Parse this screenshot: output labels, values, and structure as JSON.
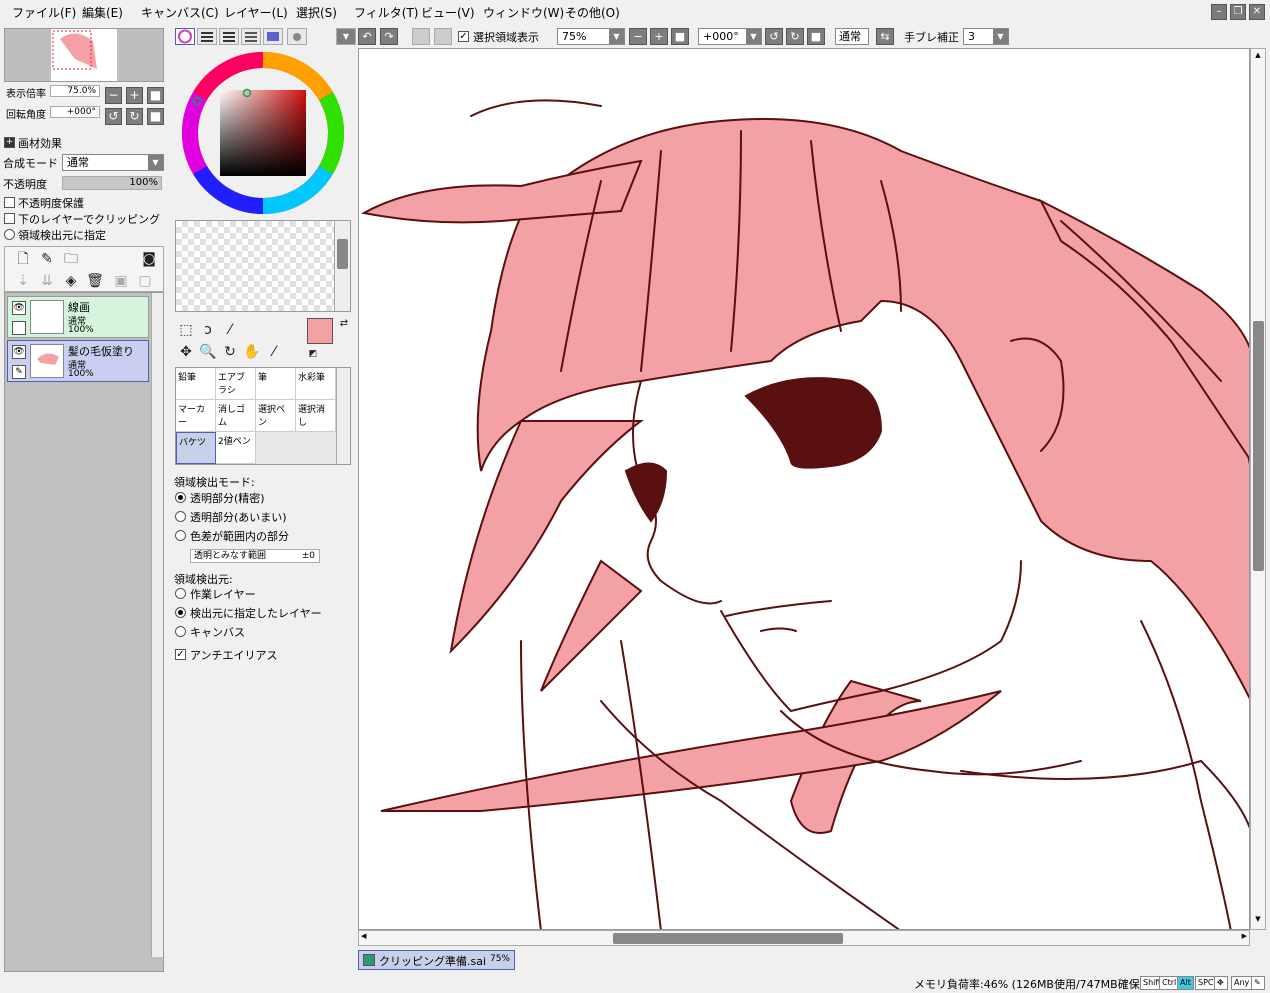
{
  "menu": {
    "items": [
      "ファイル(F)",
      "編集(E)",
      "キャンバス(C)",
      "レイヤー(L)",
      "選択(S)",
      "フィルタ(T)",
      "ビュー(V)",
      "ウィンドウ(W)",
      "その他(O)"
    ]
  },
  "navigator": {
    "zoom_label": "表示倍率",
    "zoom_value": "75.0%",
    "rotation_label": "回転角度",
    "rotation_value": "+000°"
  },
  "layer_panel": {
    "effects_label": "画材効果",
    "blend_label": "合成モード",
    "blend_value": "通常",
    "opacity_label": "不透明度",
    "opacity_value": "100%",
    "opacity_fraction": 1.0,
    "protect_opacity": "不透明度保護",
    "clip_lower": "下のレイヤーでクリッピング",
    "selection_source": "領域検出元に指定",
    "layers": [
      {
        "name": "線画",
        "mode": "通常",
        "opacity": "100%"
      },
      {
        "name": "髪の毛仮塗り",
        "mode": "通常",
        "opacity": "100%"
      }
    ]
  },
  "colors": {
    "primary": "#f4a1a6",
    "secondary": "#ffffff",
    "line": "#5a0f10",
    "hair": "#f4a1a6"
  },
  "brushes": [
    {
      "name": "鉛筆"
    },
    {
      "name": "エアブラシ"
    },
    {
      "name": "筆"
    },
    {
      "name": "水彩筆"
    },
    {
      "name": "マーカー"
    },
    {
      "name": "消しゴム"
    },
    {
      "name": "選択ペン"
    },
    {
      "name": "選択消し"
    },
    {
      "name": "バケツ"
    },
    {
      "name": "2値ペン"
    }
  ],
  "bucket_options": {
    "detect_mode_label": "領域検出モード:",
    "mode_options": [
      "透明部分(精密)",
      "透明部分(あいまい)",
      "色差が範囲内の部分"
    ],
    "range_label": "透明とみなす範囲",
    "range_value": "±0",
    "detect_source_label": "領域検出元:",
    "source_options": [
      "作業レイヤー",
      "検出元に指定したレイヤー",
      "キャンバス"
    ],
    "antialias": "アンチエイリアス"
  },
  "toolbar": {
    "show_selection": "選択領域表示",
    "zoom": "75%",
    "rotation": "+000°",
    "blend": "通常",
    "stabilizer_label": "手ブレ補正",
    "stabilizer_value": "3"
  },
  "document": {
    "name": "クリッピング準備.sai",
    "zoom": "75%"
  },
  "status": {
    "memory": "メモリ負荷率:46% (126MB使用/747MB確保)",
    "keys": [
      "Shift",
      "Ctrl",
      "Alt",
      "SPC",
      "Any"
    ]
  }
}
